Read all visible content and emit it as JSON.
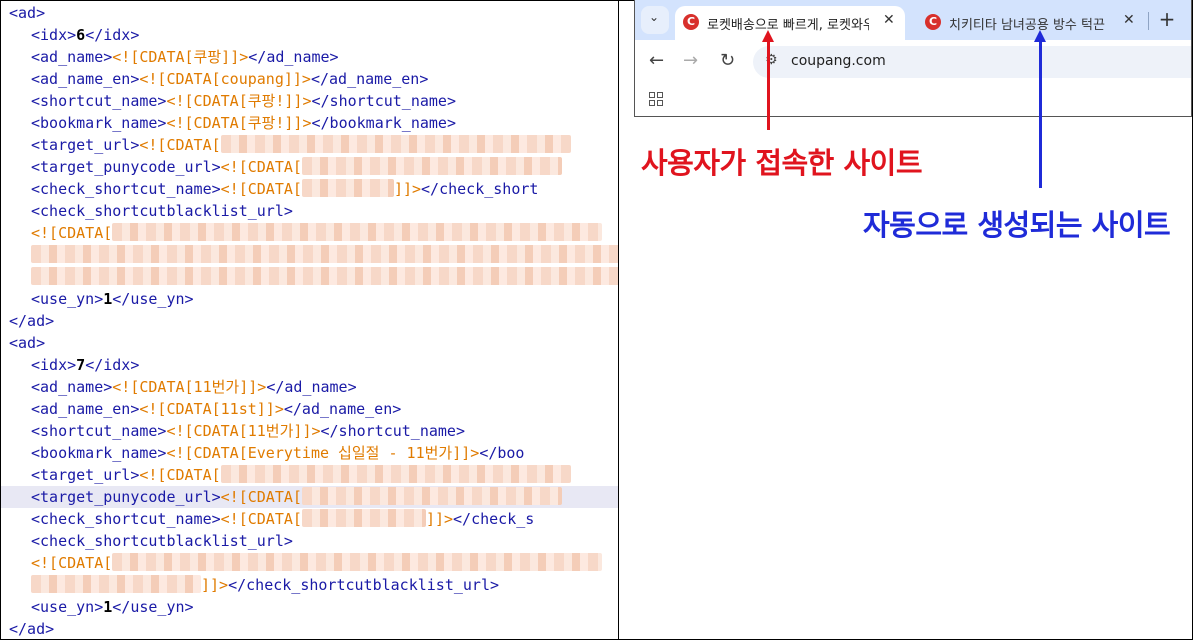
{
  "xml": {
    "ad6": {
      "open": "<ad>",
      "idx_open": "<idx>",
      "idx": "6",
      "idx_close": "</idx>",
      "ad_name_open": "<ad_name>",
      "ad_name": "<![CDATA[쿠팡]]>",
      "ad_name_close": "</ad_name>",
      "ad_name_en_open": "<ad_name_en>",
      "ad_name_en": "<![CDATA[coupang]]>",
      "ad_name_en_close": "</ad_name_en>",
      "shortcut_open": "<shortcut_name>",
      "shortcut": "<![CDATA[쿠팡!]]>",
      "shortcut_close": "</shortcut_name>",
      "bookmark_open": "<bookmark_name>",
      "bookmark": "<![CDATA[쿠팡!]]>",
      "bookmark_close": "</bookmark_name>",
      "target_open": "<target_url>",
      "target_cdata": "<![CDATA[",
      "puny_open": "<target_punycode_url>",
      "puny_cdata": "<![CDATA[",
      "check_open": "<check_shortcut_name>",
      "check_cdata": "<![CDATA[",
      "check_end": "]]>",
      "check_close": "</check_short",
      "blacklist_open": "<check_shortcutblacklist_url>",
      "blacklist_cdata": "<![CDATA[",
      "use_open": "<use_yn>",
      "use": "1",
      "use_close": "</use_yn>",
      "close": "</ad>"
    },
    "ad7": {
      "open": "<ad>",
      "idx_open": "<idx>",
      "idx": "7",
      "idx_close": "</idx>",
      "ad_name_open": "<ad_name>",
      "ad_name": "<![CDATA[11번가]]>",
      "ad_name_close": "</ad_name>",
      "ad_name_en_open": "<ad_name_en>",
      "ad_name_en": "<![CDATA[11st]]>",
      "ad_name_en_close": "</ad_name_en>",
      "shortcut_open": "<shortcut_name>",
      "shortcut": "<![CDATA[11번가]]>",
      "shortcut_close": "</shortcut_name>",
      "bookmark_open": "<bookmark_name>",
      "bookmark": "<![CDATA[Everytime 십일절 - 11번가]]>",
      "bookmark_close": "</boo",
      "target_open": "<target_url>",
      "target_cdata": "<![CDATA[",
      "puny_open": "<target_punycode_url>",
      "puny_cdata": "<![CDATA[",
      "check_open": "<check_shortcut_name>",
      "check_cdata": "<![CDATA[",
      "check_end": "]]>",
      "check_close": "</check_s",
      "blacklist_open": "<check_shortcutblacklist_url>",
      "blacklist_cdata": "<![CDATA[",
      "blacklist_end": "]]>",
      "blacklist_close": "</check_shortcutblacklist_url>",
      "use_open": "<use_yn>",
      "use": "1",
      "use_close": "</use_yn>",
      "close": "</ad>"
    }
  },
  "browser": {
    "tabs": [
      {
        "title": "로켓배송으로 빠르게, 로켓와우",
        "favicon": "C",
        "active": true
      },
      {
        "title": "치키티타 남녀공용 방수 턱끈 스",
        "favicon": "C",
        "active": false
      }
    ],
    "tab_close": "✕",
    "tab_dropdown": "⌄",
    "new_tab": "+",
    "back": "←",
    "forward": "→",
    "reload": "↻",
    "tune": "⚙",
    "url": "coupang.com"
  },
  "annotations": {
    "user_site": "사용자가 접속한 사이트",
    "auto_site": "자동으로 생성되는 사이트"
  },
  "colors": {
    "tag": "#1a1aa6",
    "cdata": "#e07b00",
    "red": "#e0141e",
    "blue": "#1f2bd8",
    "tabstrip": "#d3e3fd"
  }
}
